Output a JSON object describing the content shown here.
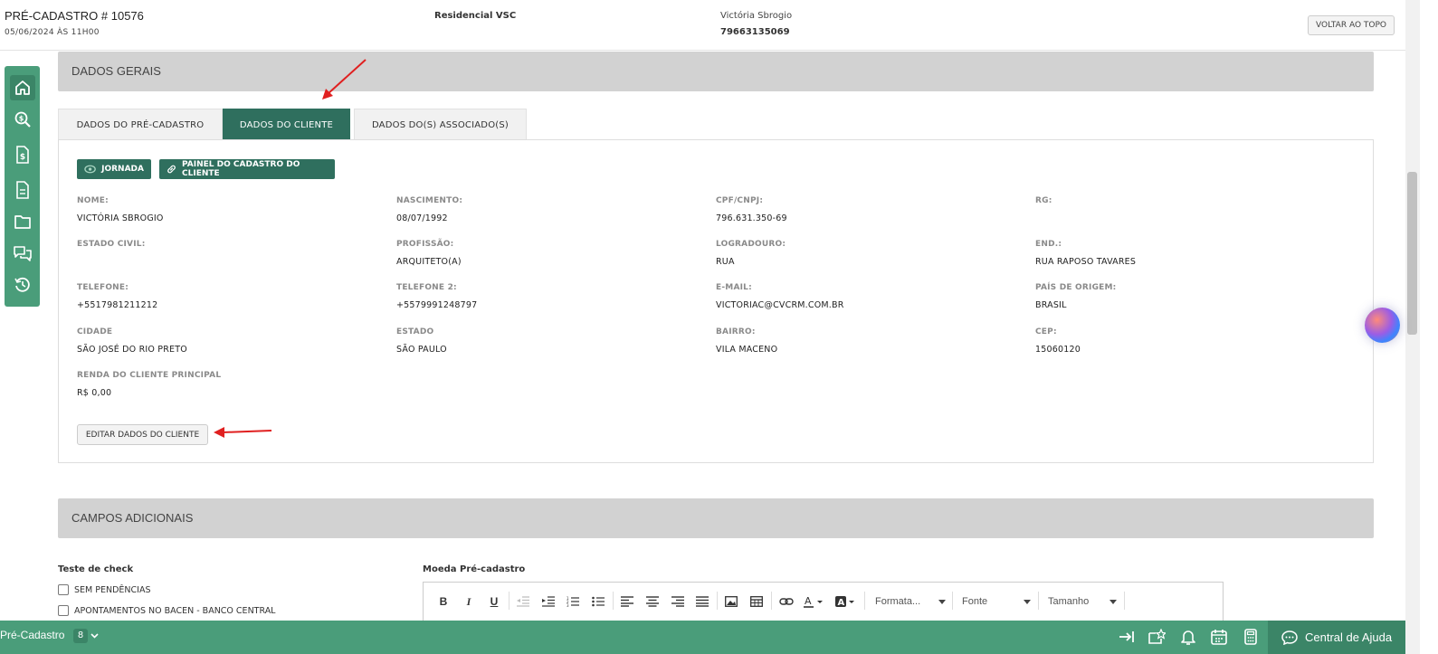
{
  "header": {
    "title": "PRÉ-CADASTRO # 10576",
    "date": "05/06/2024 ÀS 11H00",
    "empreendimento": "Residencial VSC",
    "cliente_nome": "Victória Sbrogio",
    "cliente_telefone": "79663135069",
    "voltar_label": "VOLTAR AO TOPO"
  },
  "sidebar": {
    "icons": [
      "home-icon",
      "search-dollar-icon",
      "file-dollar-icon",
      "document-icon",
      "folder-icon",
      "chat-icon",
      "history-icon"
    ]
  },
  "dados_gerais": {
    "title": "DADOS GERAIS",
    "tabs": [
      {
        "label": "DADOS DO PRÉ-CADASTRO",
        "active": false
      },
      {
        "label": "DADOS DO CLIENTE",
        "active": true
      },
      {
        "label": "DADOS DO(S) ASSOCIADO(S)",
        "active": false
      }
    ],
    "buttons": {
      "jornada": "JORNADA",
      "painel": "PAINEL DO CADASTRO DO CLIENTE",
      "editar": "EDITAR DADOS DO CLIENTE"
    },
    "fields": [
      {
        "label": "NOME:",
        "value": "VICTÓRIA SBROGIO"
      },
      {
        "label": "NASCIMENTO:",
        "value": "08/07/1992"
      },
      {
        "label": "CPF/CNPJ:",
        "value": "796.631.350-69"
      },
      {
        "label": "RG:",
        "value": ""
      },
      {
        "label": "ESTADO CIVIL:",
        "value": ""
      },
      {
        "label": "PROFISSÃO:",
        "value": "ARQUITETO(A)"
      },
      {
        "label": "LOGRADOURO:",
        "value": "RUA"
      },
      {
        "label": "END.:",
        "value": "RUA RAPOSO TAVARES"
      },
      {
        "label": "TELEFONE:",
        "value": "+5517981211212"
      },
      {
        "label": "TELEFONE 2:",
        "value": "+5579991248797"
      },
      {
        "label": "E-MAIL:",
        "value": "VICTORIAC@CVCRM.COM.BR"
      },
      {
        "label": "PAÍS DE ORIGEM:",
        "value": "BRASIL"
      },
      {
        "label": "CIDADE",
        "value": "SÃO JOSÉ DO RIO PRETO"
      },
      {
        "label": "ESTADO",
        "value": "SÃO PAULO"
      },
      {
        "label": "BAIRRO:",
        "value": "VILA MACENO"
      },
      {
        "label": "CEP:",
        "value": "15060120"
      },
      {
        "label": "RENDA DO CLIENTE PRINCIPAL",
        "value": "R$ 0,00"
      }
    ]
  },
  "campos_adicionais": {
    "title": "CAMPOS ADICIONAIS",
    "check_heading": "Teste de check",
    "checks": [
      "SEM PENDÊNCIAS",
      "APONTAMENTOS NO BACEN - BANCO CENTRAL"
    ],
    "moeda_heading": "Moeda Pré-cadastro",
    "toolbar": {
      "bold": "B",
      "italic": "I",
      "underline": "U",
      "formata": "Formata...",
      "fonte": "Fonte",
      "tamanho": "Tamanho"
    }
  },
  "bottombar": {
    "label": "Pré-Cadastro",
    "count": "8",
    "help": "Central de Ajuda"
  },
  "colors": {
    "primary": "#2f6f5e",
    "sidebar": "#4a9d7a",
    "section": "#d2d2d2",
    "arrow": "#e02020"
  }
}
